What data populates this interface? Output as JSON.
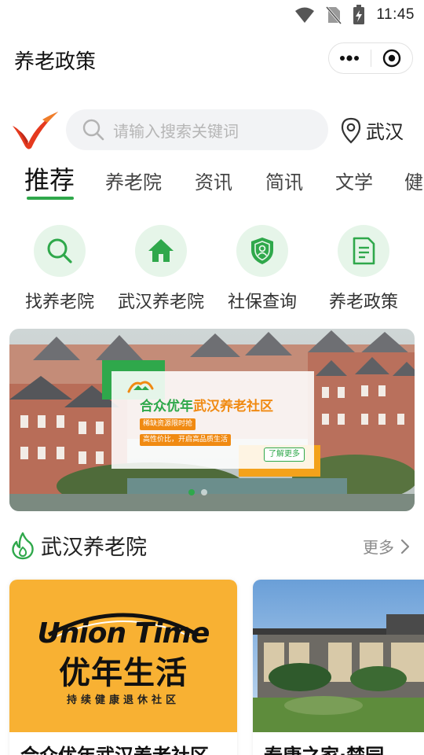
{
  "status_bar": {
    "time": "11:45",
    "icons": [
      "wifi-icon",
      "no-sim-icon",
      "battery-charging-icon"
    ]
  },
  "header": {
    "title": "养老政策",
    "menu_icon": "more-dots-icon",
    "close_icon": "target-circle-icon"
  },
  "search": {
    "placeholder": "请输入搜索关键词",
    "location": "武汉"
  },
  "tabs": [
    {
      "label": "推荐",
      "active": true
    },
    {
      "label": "养老院"
    },
    {
      "label": "资讯"
    },
    {
      "label": "简讯"
    },
    {
      "label": "文学"
    },
    {
      "label": "健"
    }
  ],
  "quick_entries": [
    {
      "label": "找养老院",
      "icon": "search-icon"
    },
    {
      "label": "武汉养老院",
      "icon": "home-icon"
    },
    {
      "label": "社保查询",
      "icon": "shield-user-icon"
    },
    {
      "label": "养老政策",
      "icon": "document-icon"
    }
  ],
  "banner": {
    "title_prefix": "合众优年",
    "title_highlight": "武汉养老社区",
    "tag1": "稀缺资源限时抢",
    "tag2": "高性价比，开启高品质生活",
    "more": "了解更多",
    "slide_count": 2,
    "active_slide": 1
  },
  "section": {
    "title": "武汉养老院",
    "more": "更多"
  },
  "cards": [
    {
      "name": "合众优年武汉养老社区",
      "logo_en": "Union Time",
      "logo_cn": "优年生活",
      "logo_sub": "持续健康退休社区"
    },
    {
      "name": "泰康之家·楚园"
    }
  ],
  "colors": {
    "accent": "#2fa84b",
    "accent_light": "#e6f5e9",
    "orange": "#f08a12",
    "card_yellow": "#f8b133"
  }
}
